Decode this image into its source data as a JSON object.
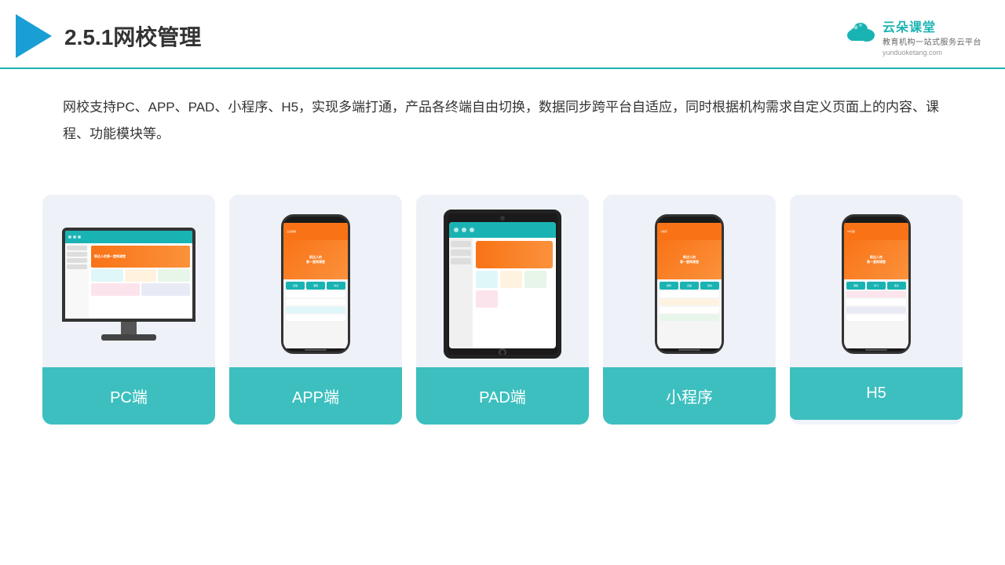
{
  "header": {
    "title": "2.5.1网校管理",
    "brand": {
      "name": "云朵课堂",
      "tagline": "教育机构一站式服务云平台",
      "url": "yunduoketang.com"
    }
  },
  "description": "网校支持PC、APP、PAD、小程序、H5，实现多端打通，产品各终端自由切换，数据同步跨平台自适应，同时根据机构需求自定义页面上的内容、课程、功能模块等。",
  "cards": [
    {
      "id": "pc",
      "label": "PC端"
    },
    {
      "id": "app",
      "label": "APP端"
    },
    {
      "id": "pad",
      "label": "PAD端"
    },
    {
      "id": "miniprogram",
      "label": "小程序"
    },
    {
      "id": "h5",
      "label": "H5"
    }
  ],
  "colors": {
    "accent": "#3dbfbf",
    "headerBorder": "#1ab3b3",
    "cardBg": "#eef2f8",
    "labelBg": "#3dbfbf"
  }
}
